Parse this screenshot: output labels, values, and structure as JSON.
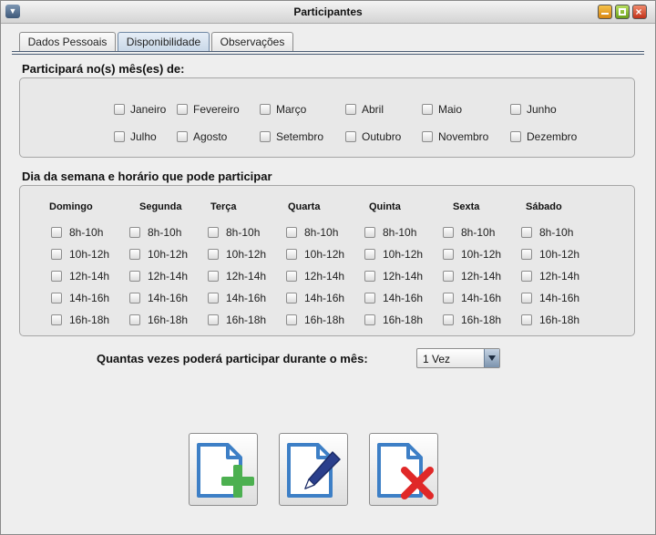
{
  "window": {
    "title": "Participantes"
  },
  "tabs": [
    {
      "label": "Dados Pessoais",
      "active": false
    },
    {
      "label": "Disponibilidade",
      "active": true
    },
    {
      "label": "Observações",
      "active": false
    }
  ],
  "months_section": {
    "title": "Participará no(s) mês(es) de:",
    "months": [
      "Janeiro",
      "Fevereiro",
      "Março",
      "Abril",
      "Maio",
      "Junho",
      "Julho",
      "Agosto",
      "Setembro",
      "Outubro",
      "Novembro",
      "Dezembro"
    ]
  },
  "schedule_section": {
    "title": "Dia da semana e horário que pode participar",
    "days": [
      "Domingo",
      "Segunda",
      "Terça",
      "Quarta",
      "Quinta",
      "Sexta",
      "Sábado"
    ],
    "slots": [
      "8h-10h",
      "10h-12h",
      "12h-14h",
      "14h-16h",
      "16h-18h"
    ]
  },
  "frequency": {
    "label": "Quantas vezes poderá participar durante o mês:",
    "selected": "1 Vez"
  },
  "actions": {
    "add_icon": "document-add-icon",
    "edit_icon": "document-edit-icon",
    "delete_icon": "document-delete-icon"
  },
  "colors": {
    "accent_blue": "#3d7fc6",
    "add_green": "#4cb050",
    "delete_red": "#e02828",
    "edit_pen": "#2a3f8c"
  }
}
